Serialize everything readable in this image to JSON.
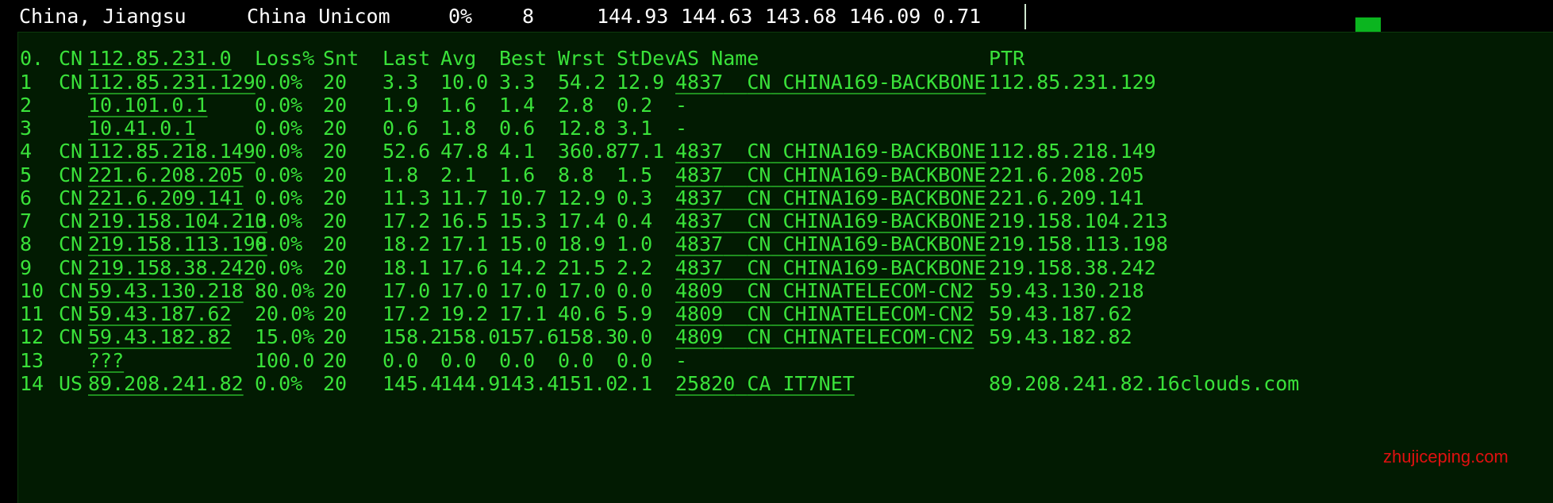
{
  "summary": {
    "location": "China, Jiangsu",
    "isp": "China Unicom",
    "loss": "0%",
    "sent": "8",
    "last": "144.93",
    "avg": "144.63",
    "best": "143.68",
    "worst": "146.09",
    "stdev": "0.71",
    "link": "show"
  },
  "mtr": {
    "columns": {
      "hop": "0.",
      "cc": "CN",
      "host": "112.85.231.0",
      "loss": "Loss%",
      "snt": "Snt",
      "last": "Last",
      "avg": "Avg",
      "best": "Best",
      "wrst": "Wrst",
      "stdev": "StDev",
      "asname": "AS Name",
      "ptr": "PTR"
    },
    "hops": [
      {
        "hop": "1",
        "cc": "CN",
        "host": "112.85.231.129",
        "loss": "0.0%",
        "snt": "20",
        "last": "3.3",
        "avg": "10.0",
        "best": "3.3",
        "wrst": "54.2",
        "stdev": "12.9",
        "asn": "4837",
        "ascc": "CN",
        "asname": "CHINA169-BACKBONE",
        "ptr": "112.85.231.129"
      },
      {
        "hop": "2",
        "cc": "",
        "host": "10.101.0.1",
        "loss": "0.0%",
        "snt": "20",
        "last": "1.9",
        "avg": "1.6",
        "best": "1.4",
        "wrst": "2.8",
        "stdev": "0.2",
        "asn": "-",
        "ascc": "",
        "asname": "",
        "ptr": ""
      },
      {
        "hop": "3",
        "cc": "",
        "host": "10.41.0.1",
        "loss": "0.0%",
        "snt": "20",
        "last": "0.6",
        "avg": "1.8",
        "best": "0.6",
        "wrst": "12.8",
        "stdev": "3.1",
        "asn": "-",
        "ascc": "",
        "asname": "",
        "ptr": ""
      },
      {
        "hop": "4",
        "cc": "CN",
        "host": "112.85.218.149",
        "loss": "0.0%",
        "snt": "20",
        "last": "52.6",
        "avg": "47.8",
        "best": "4.1",
        "wrst": "360.8",
        "stdev": "77.1",
        "asn": "4837",
        "ascc": "CN",
        "asname": "CHINA169-BACKBONE",
        "ptr": "112.85.218.149"
      },
      {
        "hop": "5",
        "cc": "CN",
        "host": "221.6.208.205",
        "loss": "0.0%",
        "snt": "20",
        "last": "1.8",
        "avg": "2.1",
        "best": "1.6",
        "wrst": "8.8",
        "stdev": "1.5",
        "asn": "4837",
        "ascc": "CN",
        "asname": "CHINA169-BACKBONE",
        "ptr": "221.6.208.205"
      },
      {
        "hop": "6",
        "cc": "CN",
        "host": "221.6.209.141",
        "loss": "0.0%",
        "snt": "20",
        "last": "11.3",
        "avg": "11.7",
        "best": "10.7",
        "wrst": "12.9",
        "stdev": "0.3",
        "asn": "4837",
        "ascc": "CN",
        "asname": "CHINA169-BACKBONE",
        "ptr": "221.6.209.141"
      },
      {
        "hop": "7",
        "cc": "CN",
        "host": "219.158.104.213",
        "loss": "0.0%",
        "snt": "20",
        "last": "17.2",
        "avg": "16.5",
        "best": "15.3",
        "wrst": "17.4",
        "stdev": "0.4",
        "asn": "4837",
        "ascc": "CN",
        "asname": "CHINA169-BACKBONE",
        "ptr": "219.158.104.213"
      },
      {
        "hop": "8",
        "cc": "CN",
        "host": "219.158.113.198",
        "loss": "0.0%",
        "snt": "20",
        "last": "18.2",
        "avg": "17.1",
        "best": "15.0",
        "wrst": "18.9",
        "stdev": "1.0",
        "asn": "4837",
        "ascc": "CN",
        "asname": "CHINA169-BACKBONE",
        "ptr": "219.158.113.198"
      },
      {
        "hop": "9",
        "cc": "CN",
        "host": "219.158.38.242",
        "loss": "0.0%",
        "snt": "20",
        "last": "18.1",
        "avg": "17.6",
        "best": "14.2",
        "wrst": "21.5",
        "stdev": "2.2",
        "asn": "4837",
        "ascc": "CN",
        "asname": "CHINA169-BACKBONE",
        "ptr": "219.158.38.242"
      },
      {
        "hop": "10",
        "cc": "CN",
        "host": "59.43.130.218",
        "loss": "80.0%",
        "snt": "20",
        "last": "17.0",
        "avg": "17.0",
        "best": "17.0",
        "wrst": "17.0",
        "stdev": "0.0",
        "asn": "4809",
        "ascc": "CN",
        "asname": "CHINATELECOM-CN2",
        "ptr": "59.43.130.218"
      },
      {
        "hop": "11",
        "cc": "CN",
        "host": "59.43.187.62",
        "loss": "20.0%",
        "snt": "20",
        "last": "17.2",
        "avg": "19.2",
        "best": "17.1",
        "wrst": "40.6",
        "stdev": "5.9",
        "asn": "4809",
        "ascc": "CN",
        "asname": "CHINATELECOM-CN2",
        "ptr": "59.43.187.62"
      },
      {
        "hop": "12",
        "cc": "CN",
        "host": "59.43.182.82",
        "loss": "15.0%",
        "snt": "20",
        "last": "158.2",
        "avg": "158.0",
        "best": "157.6",
        "wrst": "158.3",
        "stdev": "0.0",
        "asn": "4809",
        "ascc": "CN",
        "asname": "CHINATELECOM-CN2",
        "ptr": "59.43.182.82"
      },
      {
        "hop": "13",
        "cc": "",
        "host": "???",
        "loss": "100.0",
        "snt": "20",
        "last": "0.0",
        "avg": "0.0",
        "best": "0.0",
        "wrst": "0.0",
        "stdev": "0.0",
        "asn": "-",
        "ascc": "",
        "asname": "",
        "ptr": ""
      },
      {
        "hop": "14",
        "cc": "US",
        "host": "89.208.241.82",
        "loss": "0.0%",
        "snt": "20",
        "last": "145.4",
        "avg": "144.9",
        "best": "143.4",
        "wrst": "151.0",
        "stdev": "2.1",
        "asn": "25820",
        "ascc": "CA",
        "asname": "IT7NET",
        "ptr": "89.208.241.82.16clouds.com"
      }
    ]
  },
  "watermark": "zhujiceping.com",
  "colors": {
    "terminal_green": "#3ae23a",
    "panel_background": "#021b02",
    "summary_text": "#ffffff",
    "watermark_red": "#e01010"
  }
}
